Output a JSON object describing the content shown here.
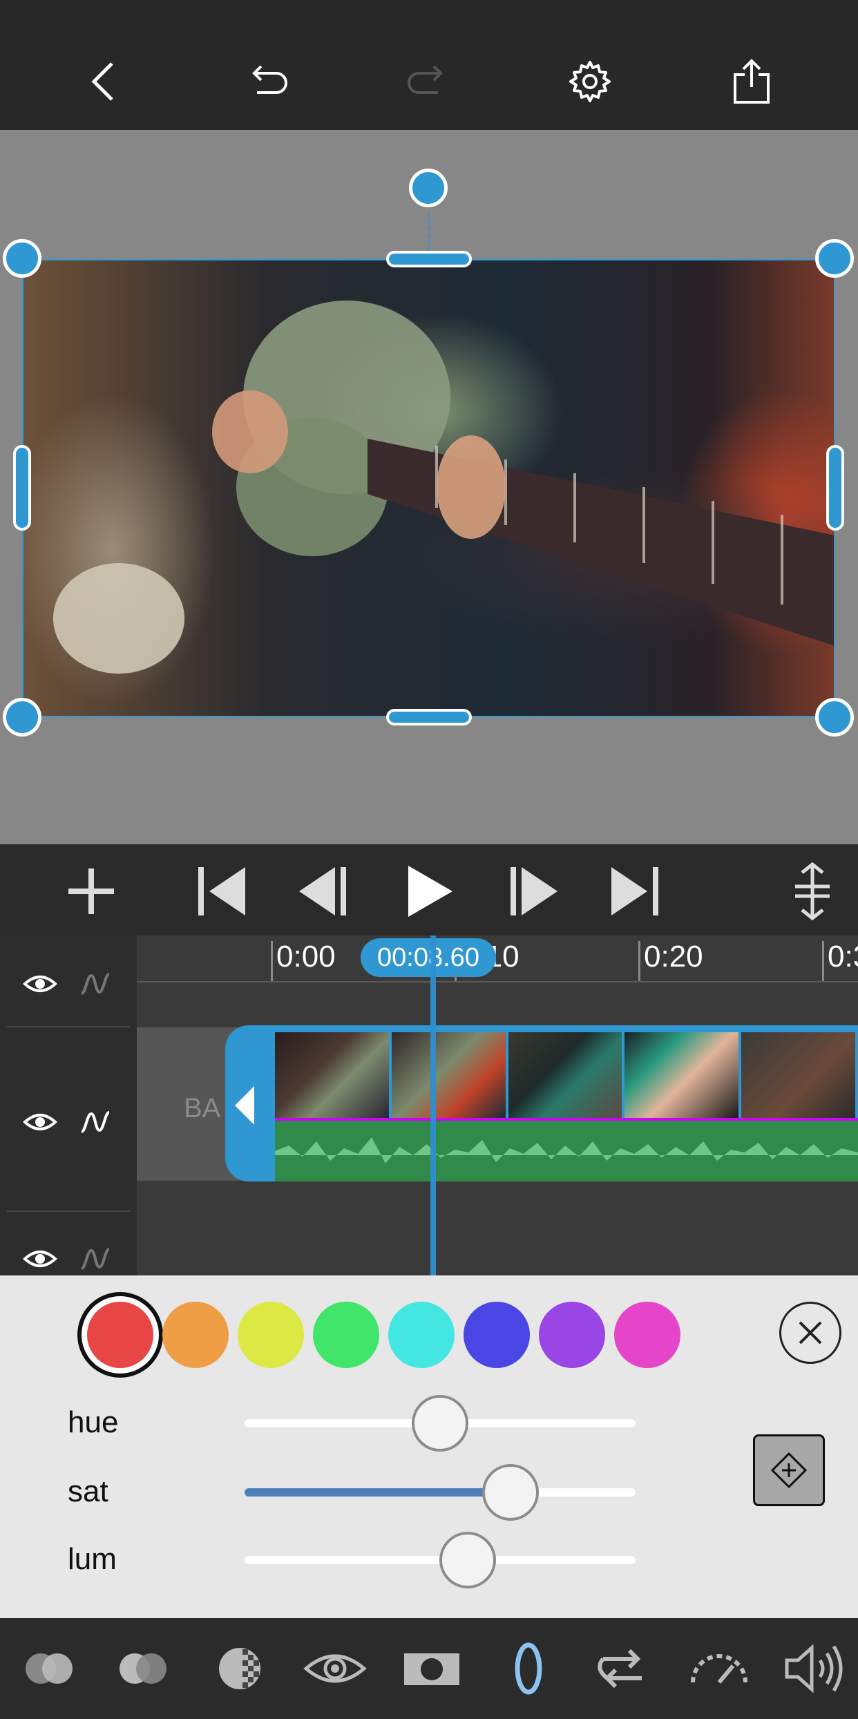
{
  "toolbar": {
    "icons": [
      "back-icon",
      "undo-icon",
      "redo-icon",
      "settings-icon",
      "share-icon"
    ]
  },
  "transport": {
    "icons": [
      "add-icon",
      "skip-to-start-icon",
      "step-back-icon",
      "play-icon",
      "step-forward-icon",
      "skip-to-end-icon",
      "track-height-icon"
    ]
  },
  "timeline": {
    "ruler_labels": [
      "0:00",
      "0:10",
      "0:20",
      "0:3"
    ],
    "current_time": "00:08.60",
    "clip_label": "BA"
  },
  "color_panel": {
    "swatches": [
      {
        "name": "red",
        "color": "#e84545",
        "selected": true
      },
      {
        "name": "orange",
        "color": "#ef9e45",
        "selected": false
      },
      {
        "name": "yellow",
        "color": "#dce844",
        "selected": false
      },
      {
        "name": "green",
        "color": "#40e56a",
        "selected": false
      },
      {
        "name": "cyan",
        "color": "#44e6e2",
        "selected": false
      },
      {
        "name": "blue",
        "color": "#4a45e5",
        "selected": false
      },
      {
        "name": "purple",
        "color": "#9a45e5",
        "selected": false
      },
      {
        "name": "magenta",
        "color": "#e545c8",
        "selected": false
      }
    ],
    "sliders": [
      {
        "label": "hue",
        "value": 0.5
      },
      {
        "label": "sat",
        "value": 0.68
      },
      {
        "label": "lum",
        "value": 0.57
      }
    ]
  },
  "bottom_tools": {
    "icons": [
      "blend-mode-icon",
      "blend-mode-alt-icon",
      "opacity-icon",
      "eye-icon",
      "mask-icon",
      "color-adjust-icon",
      "reverse-icon",
      "speed-icon",
      "volume-icon"
    ]
  },
  "colors": {
    "accent": "#2f97d2",
    "audio_waveform": "#308a4a",
    "keyframe_bg": "#a8a8a8"
  }
}
